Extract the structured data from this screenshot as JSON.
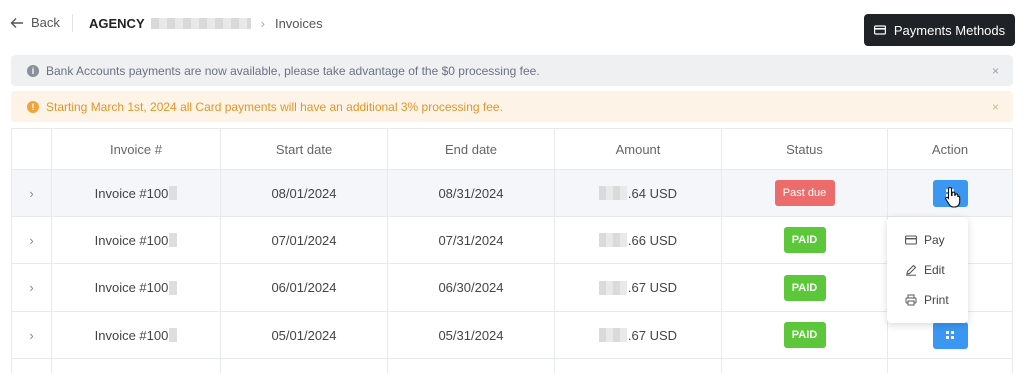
{
  "topbar": {
    "back_label": "Back",
    "agency_label": "AGENCY",
    "current_crumb": "Invoices",
    "payments_methods_label": "Payments Methods"
  },
  "alerts": {
    "info_text": "Bank Accounts payments are now available, please take advantage of the $0 processing fee.",
    "warn_text": "Starting March 1st, 2024 all Card payments will have an additional 3% processing fee.",
    "close_glyph": "×"
  },
  "table": {
    "headers": [
      "Invoice #",
      "Start date",
      "End date",
      "Amount",
      "Status",
      "Action"
    ],
    "rows": [
      {
        "invoice": "Invoice #100",
        "start": "08/01/2024",
        "end": "08/31/2024",
        "amount": ".64 USD",
        "status": "Past due"
      },
      {
        "invoice": "Invoice #100",
        "start": "07/01/2024",
        "end": "07/31/2024",
        "amount": ".66 USD",
        "status": "PAID"
      },
      {
        "invoice": "Invoice #100",
        "start": "06/01/2024",
        "end": "06/30/2024",
        "amount": ".67 USD",
        "status": "PAID"
      },
      {
        "invoice": "Invoice #100",
        "start": "05/01/2024",
        "end": "05/31/2024",
        "amount": ".67 USD",
        "status": "PAID"
      }
    ]
  },
  "action_menu": {
    "items": [
      "Pay",
      "Edit",
      "Print"
    ]
  },
  "colors": {
    "past_due": "#ec6b6b",
    "paid": "#5cc73b",
    "action": "#3b97f2",
    "dark_button": "#1f2227"
  }
}
